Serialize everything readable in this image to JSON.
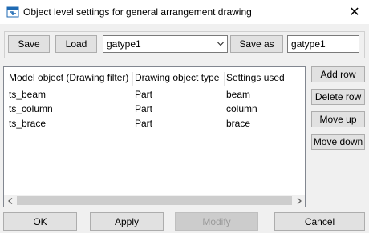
{
  "window": {
    "title": "Object level settings for general arrangement drawing",
    "close_glyph": "✕"
  },
  "toolbar": {
    "save_label": "Save",
    "load_label": "Load",
    "settings_select_value": "gatype1",
    "save_as_label": "Save as",
    "save_as_value": "gatype1"
  },
  "table": {
    "columns": [
      "Model object (Drawing filter)",
      "Drawing object type",
      "Settings used"
    ],
    "rows": [
      [
        "ts_beam",
        "Part",
        "beam"
      ],
      [
        "ts_column",
        "Part",
        "column"
      ],
      [
        "ts_brace",
        "Part",
        "brace"
      ]
    ]
  },
  "side_buttons": {
    "add_row": "Add row",
    "delete_row": "Delete row",
    "move_up": "Move up",
    "move_down": "Move down"
  },
  "bottom_buttons": {
    "ok": "OK",
    "apply": "Apply",
    "modify": "Modify",
    "cancel": "Cancel"
  },
  "icons": {
    "app": "tekla-dialog-icon",
    "close": "close-icon",
    "dropdown": "chevron-down-icon",
    "scroll_left": "scroll-left-icon",
    "scroll_right": "scroll-right-icon"
  },
  "colors": {
    "dialog_bg": "#f0f0f0",
    "button_bg": "#e1e1e1",
    "button_border": "#adadad",
    "disabled_text": "#9a9a9a",
    "app_icon": "#1f6ab3"
  }
}
